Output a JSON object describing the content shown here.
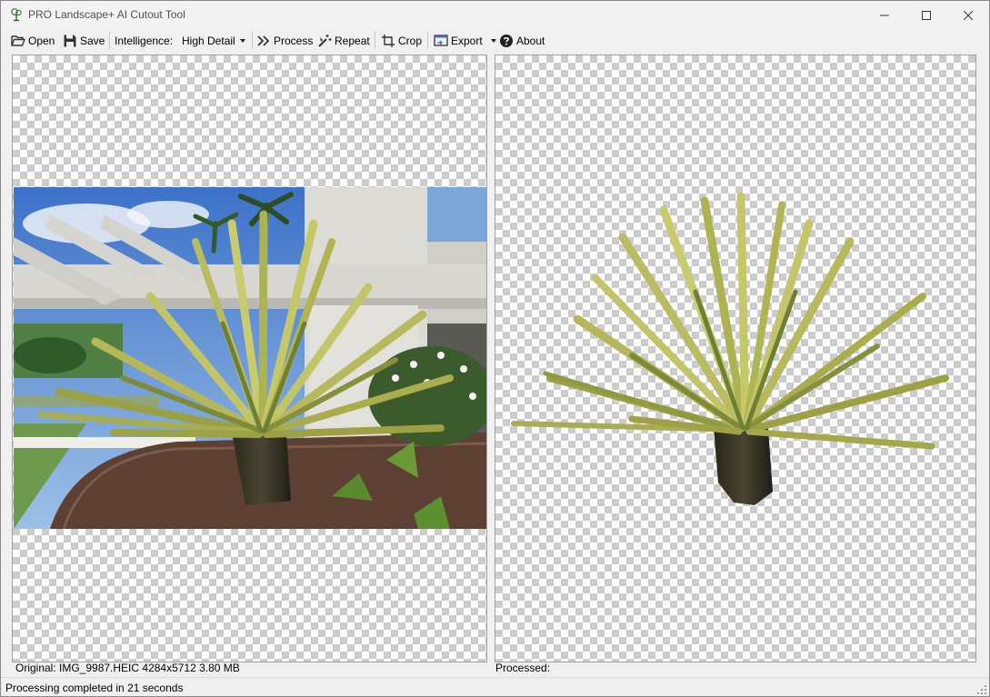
{
  "window": {
    "title": "PRO Landscape+ AI Cutout Tool",
    "icon": "tree-icon",
    "controls": [
      "minimize-icon",
      "maximize-icon",
      "close-icon"
    ]
  },
  "toolbar": {
    "open_label": "Open",
    "save_label": "Save",
    "intelligence_label": "Intelligence:",
    "intelligence_value": "High Detail",
    "process_label": "Process",
    "repeat_label": "Repeat",
    "crop_label": "Crop",
    "export_label": "Export",
    "about_label": "About"
  },
  "panels": {
    "original_caption": "Original: IMG_9987.HEIC 4284x5712 3.80 MB",
    "processed_caption": "Processed:"
  },
  "status": {
    "message": "Processing completed in 21 seconds"
  },
  "colors": {
    "checker_dark": "#cccccc",
    "checker_light": "#ffffff",
    "window_bg": "#f0f0f0"
  }
}
